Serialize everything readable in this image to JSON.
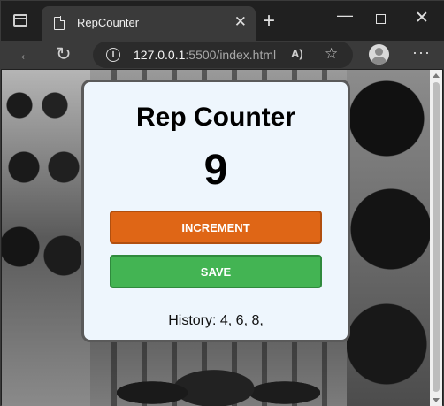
{
  "browser": {
    "tab_title": "RepCounter",
    "tab_close": "✕",
    "new_tab": "+",
    "url_host": "127.0.0.1",
    "url_rest": ":5500/index.html",
    "icons": {
      "tab_actions": "tab-actions-icon",
      "favicon": "page-icon",
      "back": "back-arrow-icon",
      "reload": "reload-icon",
      "info": "info-icon",
      "read_aloud": "read-aloud-icon",
      "favorites": "add-favorite-icon",
      "profile": "profile-icon",
      "more": "more-options-icon"
    },
    "glyphs": {
      "back": "←",
      "reload": "↻",
      "info": "i",
      "read_aloud": "A)",
      "favorites": "☆",
      "more": "···",
      "minimize": "—",
      "close": "✕"
    }
  },
  "app": {
    "title": "Rep Counter",
    "count": "9",
    "increment_label": "INCREMENT",
    "save_label": "SAVE",
    "history_text": "History: 4, 6, 8,",
    "colors": {
      "card_bg": "#eef6fd",
      "increment_bg": "#df6616",
      "save_bg": "#43b453"
    }
  }
}
